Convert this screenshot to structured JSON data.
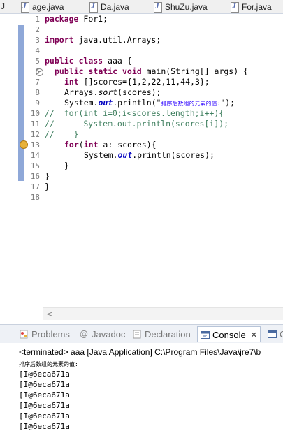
{
  "editor_tabs": [
    {
      "label": "age.java"
    },
    {
      "label": "Da.java"
    },
    {
      "label": "ShuZu.java"
    },
    {
      "label": "For.java"
    }
  ],
  "left_panel_fragment": "J",
  "line_numbers": [
    "1",
    "2",
    "3",
    "4",
    "5",
    "6",
    "7",
    "8",
    "9",
    "10",
    "11",
    "12",
    "13",
    "14",
    "15",
    "16",
    "17",
    "18"
  ],
  "code": {
    "l1_kw": "package",
    "l1_rest": " For1;",
    "l3_kw": "import",
    "l3_rest": " java.util.Arrays;",
    "l5_kw1": "public",
    "l5_kw2": "class",
    "l5_rest": " aaa {",
    "l6_kw1": "public",
    "l6_kw2": "static",
    "l6_kw3": "void",
    "l6_rest": " main(String[] args) {",
    "l7_kw": "int",
    "l7_rest": " []scores={1,2,22,11,44,3};",
    "l8_a": "Arrays.",
    "l8_m": "sort",
    "l8_b": "(scores);",
    "l9_a": "System.",
    "l9_f": "out",
    "l9_b": ".println(\"",
    "l9_s": "排序后数组的元素的值:",
    "l9_c": "\");",
    "l10": "//  for(int i=0;i<scores.length;i++){",
    "l11": "//      System.out.println(scores[i]);",
    "l12": "//    }",
    "l13_kw": "for",
    "l13_a": "(",
    "l13_kw2": "int",
    "l13_b": " a: scores){",
    "l14_a": "System.",
    "l14_f": "out",
    "l14_b": ".println(scores);",
    "l15": "}",
    "l16": "}",
    "l17": "}"
  },
  "view_tabs": [
    {
      "label": "Problems"
    },
    {
      "label": "Javadoc"
    },
    {
      "label": "Declaration"
    },
    {
      "label": "Console",
      "close": "✕"
    },
    {
      "label": "C"
    }
  ],
  "console": {
    "terminated": "<terminated> aaa [Java Application] C:\\Program Files\\Java\\jre7\\b",
    "output": [
      "排序后数组的元素的值:",
      "[I@6eca671a",
      "[I@6eca671a",
      "[I@6eca671a",
      "[I@6eca671a",
      "[I@6eca671a",
      "[I@6eca671a"
    ]
  },
  "colors": {
    "keyword": "#7f0055",
    "string": "#2a00ff",
    "comment": "#3f7f5f",
    "field": "#0000c0"
  }
}
